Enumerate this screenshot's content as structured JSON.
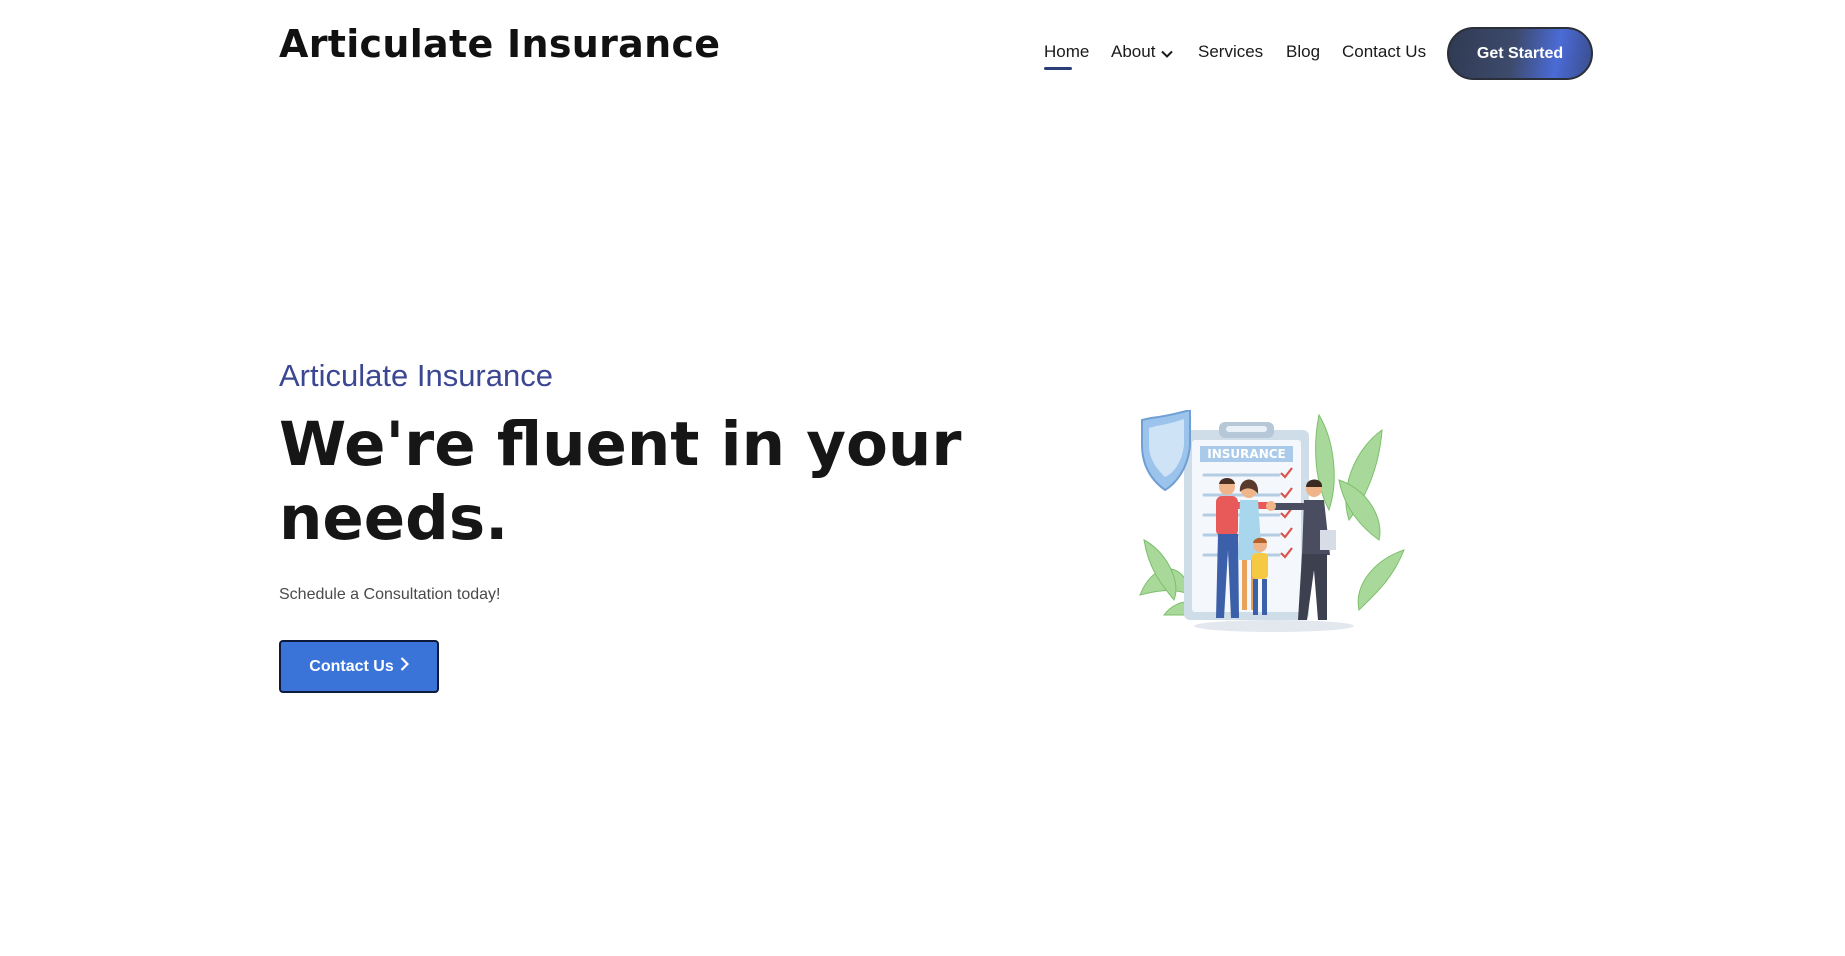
{
  "header": {
    "logo_text": "Articulate Insurance",
    "nav": [
      {
        "label": "Home",
        "active": true
      },
      {
        "label": "About",
        "has_dropdown": true
      },
      {
        "label": "Services"
      },
      {
        "label": "Blog"
      },
      {
        "label": "Contact Us"
      }
    ],
    "cta_label": "Get Started"
  },
  "hero": {
    "kicker": "Articulate Insurance",
    "title": "We're fluent in your needs.",
    "subtitle": "Schedule a Consultation today!",
    "button_label": "Contact Us",
    "button_icon": "chevron-right-icon",
    "illustration": {
      "clipboard_label": "INSURANCE",
      "depicts": "family-shaking-hands-with-insurance-agent"
    }
  },
  "colors": {
    "accent": "#3b4793",
    "button_blue": "#3b74d8",
    "text_dark": "#161616",
    "nav_underline": "#2a3f7a"
  }
}
